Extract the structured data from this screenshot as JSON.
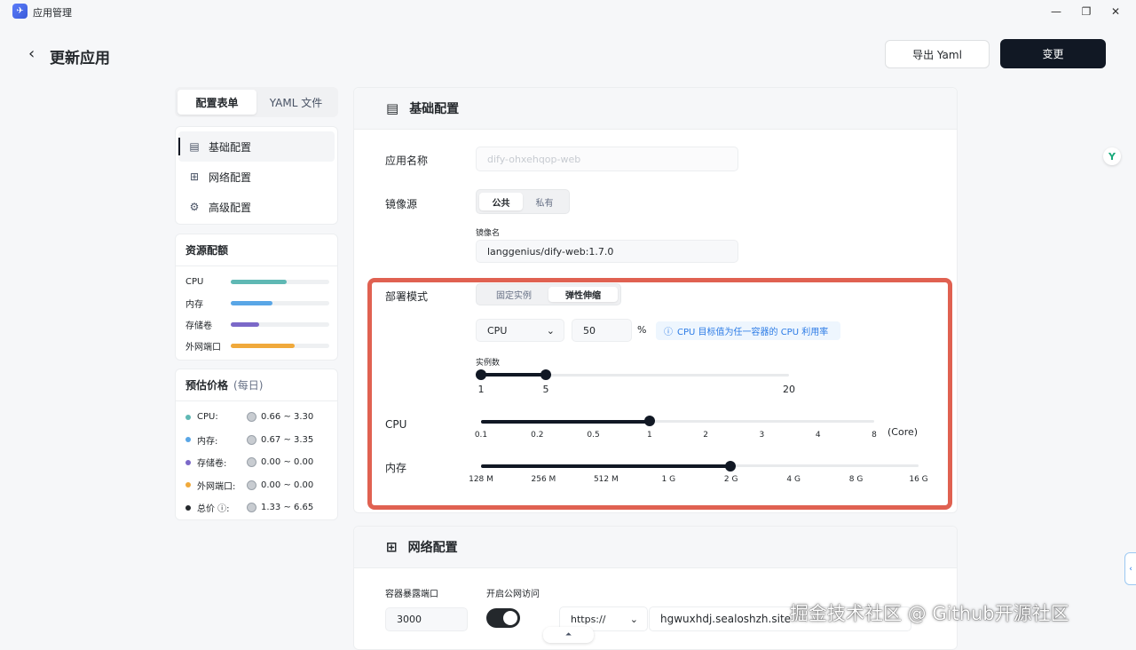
{
  "window": {
    "title": "应用管理",
    "controls": [
      "—",
      "❐",
      "✕"
    ]
  },
  "header": {
    "back_icon": "‹",
    "title": "更新应用",
    "export_label": "导出 Yaml",
    "change_label": "变更"
  },
  "tabs": [
    {
      "label": "配置表单",
      "active": true
    },
    {
      "label": "YAML 文件",
      "active": false
    }
  ],
  "nav": [
    {
      "label": "基础配置",
      "icon": "document-icon",
      "glyph": "▤",
      "active": true
    },
    {
      "label": "网络配置",
      "icon": "network-icon",
      "glyph": "⊞",
      "active": false
    },
    {
      "label": "高级配置",
      "icon": "gear-icon",
      "glyph": "⚙",
      "active": false
    }
  ],
  "resources": {
    "title": "资源配额",
    "items": [
      {
        "label": "CPU",
        "fill": 0.57,
        "color": "#5fb8b4"
      },
      {
        "label": "内存",
        "fill": 0.42,
        "color": "#59a6e6"
      },
      {
        "label": "存储卷",
        "fill": 0.29,
        "color": "#7b68c8"
      },
      {
        "label": "外网端口",
        "fill": 0.65,
        "color": "#f0a93b"
      }
    ]
  },
  "price": {
    "title": "预估价格",
    "period": "(每日)",
    "items": [
      {
        "label": "CPU:",
        "value": "0.66 ~ 3.30",
        "color": "#5fb8b4"
      },
      {
        "label": "内存:",
        "value": "0.67 ~ 3.35",
        "color": "#59a6e6"
      },
      {
        "label": "存储卷:",
        "value": "0.00 ~ 0.00",
        "color": "#7b68c8"
      },
      {
        "label": "外网端口:",
        "value": "0.00 ~ 0.00",
        "color": "#f0a93b"
      },
      {
        "label": "总价 ⓘ:",
        "value": "1.33 ~ 6.65",
        "color": "#24282c"
      }
    ]
  },
  "basic": {
    "title": "基础配置",
    "app_name_label": "应用名称",
    "app_name_value": "dify-ohxehqop-web",
    "image_source_label": "镜像源",
    "image_source_options": [
      "公共",
      "私有"
    ],
    "image_name_label": "镜像名",
    "image_name_value": "langgenius/dify-web:1.7.0",
    "deploy_mode_label": "部署模式",
    "deploy_mode_options": [
      "固定实例",
      "弹性伸缩"
    ],
    "metric_select": "CPU",
    "metric_select_caret": "⌄",
    "threshold_value": "50",
    "threshold_unit": "%",
    "hint_icon": "ⓘ",
    "hint": "CPU 目标值为任一容器的 CPU 利用率",
    "instances_label": "实例数",
    "instances_min": "1",
    "instances_max_selected": "5",
    "instances_limit": "20",
    "cpu_label": "CPU",
    "cpu_ticks": [
      "0.1",
      "0.2",
      "0.5",
      "1",
      "2",
      "3",
      "4",
      "8"
    ],
    "cpu_selected_index": 3,
    "cpu_unit": "(Core)",
    "memory_label": "内存",
    "memory_ticks": [
      "128 M",
      "256 M",
      "512 M",
      "1 G",
      "2 G",
      "4 G",
      "8 G",
      "16 G"
    ],
    "memory_selected_index": 4
  },
  "network": {
    "title": "网络配置",
    "port_label": "容器暴露端口",
    "port_value": "3000",
    "public_label": "开启公网访问",
    "public_enabled": true,
    "protocol": "https://",
    "domain": "hgwuxhdj.sealoshzh.site"
  },
  "watermark": "掘金技术社区 @ Github开源社区",
  "side_pill": "‹",
  "float_icon": "Y",
  "scroll_up": "⏶"
}
